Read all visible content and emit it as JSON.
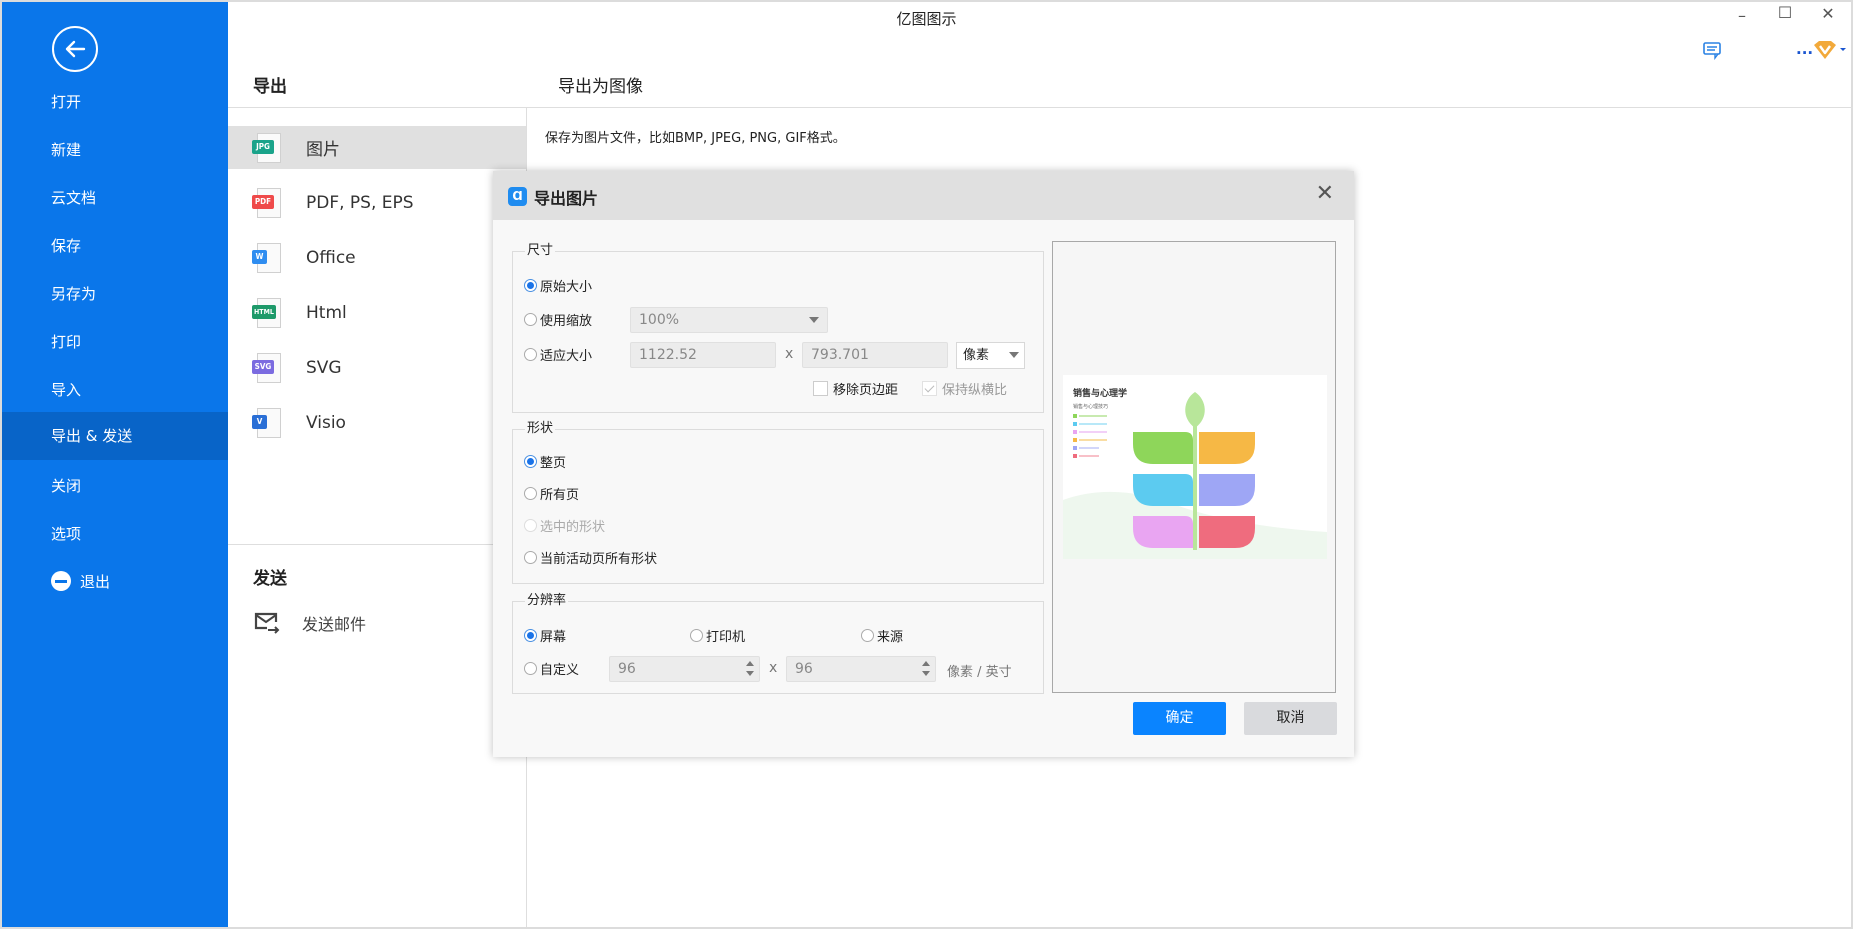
{
  "app": {
    "title": "亿图图示",
    "window_controls": {
      "minimize": "–",
      "maximize": "☐",
      "close": "✕"
    },
    "toolbar": {
      "chat_icon": "chat-icon",
      "more_label": "...",
      "vip_icon": "vip-badge-icon"
    }
  },
  "sidebar": {
    "back_icon": "back-arrow-icon",
    "items": [
      {
        "label": "打开",
        "active": false
      },
      {
        "label": "新建",
        "active": false
      },
      {
        "label": "云文档",
        "active": false
      },
      {
        "label": "保存",
        "active": false
      },
      {
        "label": "另存为",
        "active": false
      },
      {
        "label": "打印",
        "active": false
      },
      {
        "label": "导入",
        "active": false
      },
      {
        "label": "导出 & 发送",
        "active": true
      },
      {
        "label": "关闭",
        "active": false
      },
      {
        "label": "选项",
        "active": false
      },
      {
        "label": "退出",
        "active": false,
        "icon": "minus-circle-icon"
      }
    ]
  },
  "export_panel": {
    "header": "导出",
    "items": [
      {
        "label": "图片",
        "tag": "JPG",
        "color": "#1aa38a",
        "active": true
      },
      {
        "label": "PDF, PS, EPS",
        "tag": "PDF",
        "color": "#ef4a4a",
        "active": false
      },
      {
        "label": "Office",
        "tag": "W",
        "color": "#2f8df0",
        "active": false
      },
      {
        "label": "Html",
        "tag": "HTML",
        "color": "#1e9a6a",
        "active": false
      },
      {
        "label": "SVG",
        "tag": "SVG",
        "color": "#7b6be0",
        "active": false
      },
      {
        "label": "Visio",
        "tag": "V",
        "color": "#2a6fd6",
        "active": false
      }
    ],
    "send_header": "发送",
    "send_items": [
      {
        "label": "发送邮件",
        "icon": "mail-send-icon"
      }
    ]
  },
  "detail": {
    "header": "导出为图像",
    "description": "保存为图片文件，比如BMP, JPEG, PNG, GIF格式。"
  },
  "dialog": {
    "title": "导出图片",
    "logo": "Ɑ",
    "close": "✕",
    "size_group": {
      "label": "尺寸",
      "options": [
        {
          "label": "原始大小",
          "checked": true
        },
        {
          "label": "使用缩放",
          "checked": false
        },
        {
          "label": "适应大小",
          "checked": false
        }
      ],
      "zoom_value": "100%",
      "width_value": "1122.52",
      "height_value": "793.701",
      "separator": "x",
      "unit": "像素",
      "remove_margin_label": "移除页边距",
      "remove_margin_checked": false,
      "keep_ratio_label": "保持纵横比",
      "keep_ratio_checked": true
    },
    "shape_group": {
      "label": "形状",
      "options": [
        {
          "label": "整页",
          "checked": true,
          "disabled": false
        },
        {
          "label": "所有页",
          "checked": false,
          "disabled": false
        },
        {
          "label": "选中的形状",
          "checked": false,
          "disabled": true
        },
        {
          "label": "当前活动页所有形状",
          "checked": false,
          "disabled": false
        }
      ]
    },
    "resolution_group": {
      "label": "分辨率",
      "options": [
        {
          "label": "屏幕",
          "checked": true
        },
        {
          "label": "打印机",
          "checked": false
        },
        {
          "label": "来源",
          "checked": false
        },
        {
          "label": "自定义",
          "checked": false
        }
      ],
      "dpi_x": "96",
      "dpi_y": "96",
      "separator": "x",
      "unit": "像素 / 英寸"
    },
    "preview": {
      "title": "销售与心理学",
      "subtitle": "销售与心理技巧",
      "leaf_colors": [
        "#8ed65a",
        "#f6b845",
        "#5ccbf0",
        "#9ea6f5",
        "#e9a5f2",
        "#ef6c7e"
      ]
    },
    "ok_label": "确定",
    "cancel_label": "取消"
  }
}
